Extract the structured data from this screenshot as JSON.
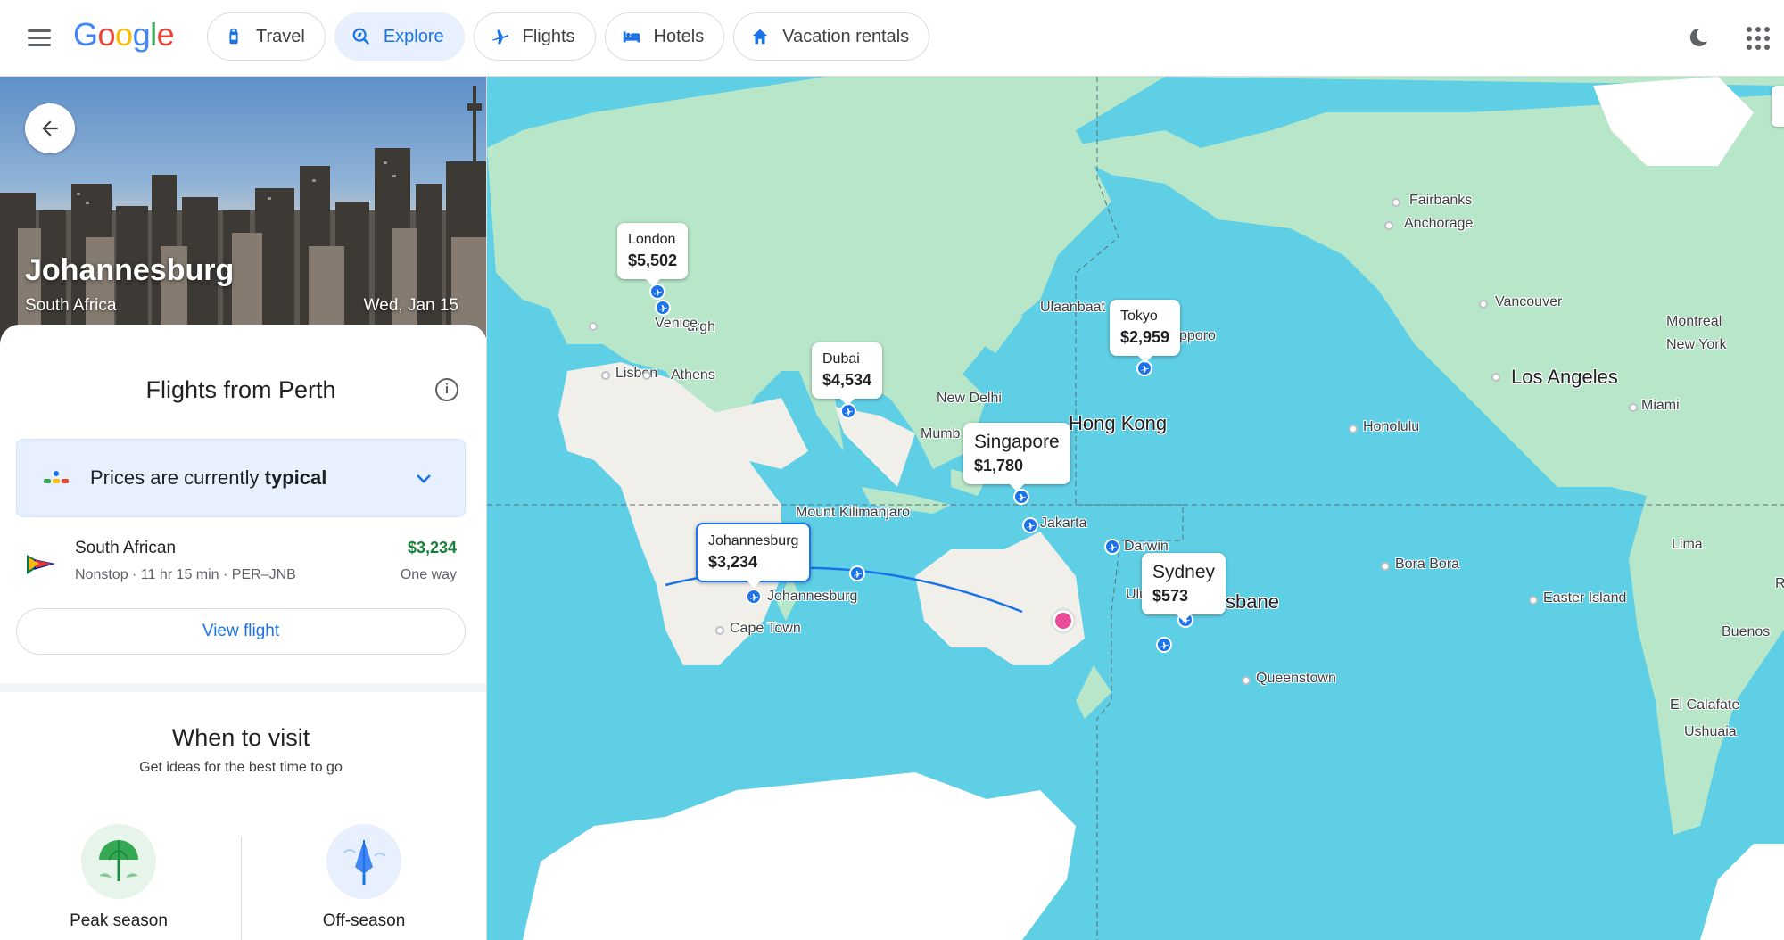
{
  "header": {
    "logo": "Google",
    "chips": [
      {
        "label": "Travel",
        "icon": "suitcase-icon",
        "active": false
      },
      {
        "label": "Explore",
        "icon": "explore-icon",
        "active": true
      },
      {
        "label": "Flights",
        "icon": "plane-icon",
        "active": false
      },
      {
        "label": "Hotels",
        "icon": "bed-icon",
        "active": false
      },
      {
        "label": "Vacation rentals",
        "icon": "house-icon",
        "active": false
      }
    ]
  },
  "destination": {
    "city": "Johannesburg",
    "country": "South Africa",
    "date": "Wed, Jan 15"
  },
  "flights": {
    "title": "Flights from Perth",
    "price_status_prefix": "Prices are currently ",
    "price_status_level": "typical",
    "option": {
      "airline": "South African",
      "details": "Nonstop · 11 hr 15 min · PER–JNB",
      "price": "$3,234",
      "trip_type": "One way"
    },
    "view_button": "View flight"
  },
  "visit": {
    "title": "When to visit",
    "subtitle": "Get ideas for the best time to go",
    "seasons": [
      "Peak season",
      "Off-season"
    ]
  },
  "map": {
    "price_tags": [
      {
        "city": "London",
        "price": "$5,502"
      },
      {
        "city": "Dubai",
        "price": "$4,534"
      },
      {
        "city": "Tokyo",
        "price": "$2,959"
      },
      {
        "city": "Singapore",
        "price": "$1,780"
      },
      {
        "city": "Johannesburg",
        "price": "$3,234"
      },
      {
        "city": "Sydney",
        "price": "$573"
      }
    ],
    "labels": {
      "fairbanks": "Fairbanks",
      "anchorage": "Anchorage",
      "vancouver": "Vancouver",
      "montreal": "Montreal",
      "newyork": "New York",
      "losangeles": "Los Angeles",
      "miami": "Miami",
      "honolulu": "Honolulu",
      "lisbon": "Lisbon",
      "venice": "Venice",
      "athens": "Athens",
      "edinburgh_frag": "urgh",
      "ulaanbaatar_frag": "Ulaanbaat",
      "sapporo_frag": "pporo",
      "newdelhi": "New Delhi",
      "mumbai_frag": "Mumb",
      "hongkong": "Hong Kong",
      "kilimanjaro": "Mount Kilimanjaro",
      "jakarta": "Jakarta",
      "darwin": "Darwin",
      "johannesburg": "Johannesburg",
      "capetown": "Cape Town",
      "uluru_frag": "Ulu",
      "brisbane_frag": "sbane",
      "queenstown": "Queenstown",
      "borabora": "Bora Bora",
      "easterisland": "Easter Island",
      "lima": "Lima",
      "buenos_frag": "Buenos",
      "elcalafate": "El Calafate",
      "ushuaia": "Ushuaia",
      "rio_frag": "R"
    }
  },
  "colors": {
    "accent": "#1a73e8",
    "price_green": "#188038",
    "ocean": "#5fcfe6",
    "land": "#b8e6c8",
    "origin": "#ea4c9a"
  }
}
